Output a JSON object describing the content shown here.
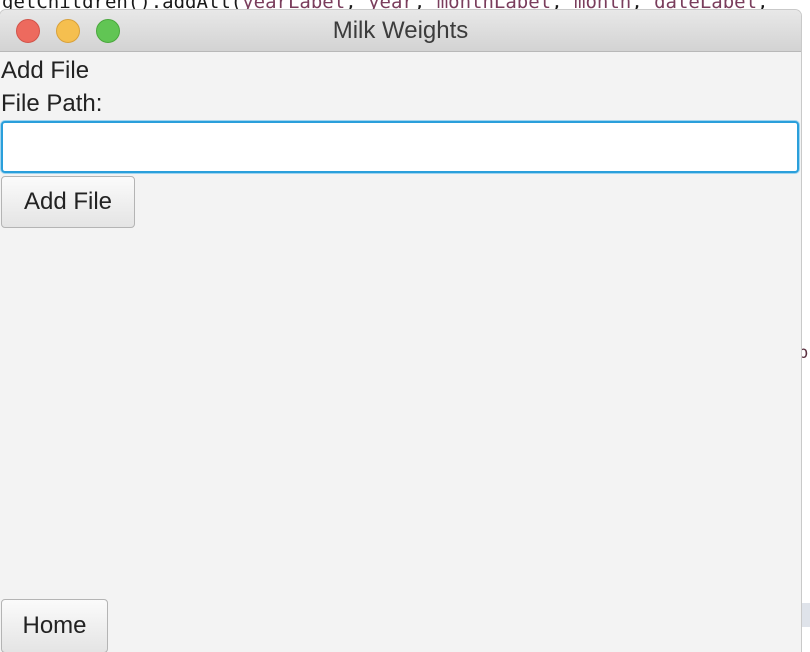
{
  "background": {
    "code_text_plain_1": "getChildren().addAll(",
    "code_text_hl_1": "yearLabel",
    "code_text_plain_2": ", ",
    "code_text_hl_2": "year",
    "code_text_plain_3": ", ",
    "code_text_hl_3": "monthLabel",
    "code_text_plain_4": ", ",
    "code_text_hl_4": "month",
    "code_text_plain_5": ", ",
    "code_text_hl_5": "dateLabel",
    "code_text_plain_6": ",",
    "code_fragment": "b"
  },
  "window": {
    "title": "Milk Weights"
  },
  "form": {
    "heading": "Add File",
    "file_path_label": "File Path:",
    "file_path_value": "",
    "file_path_placeholder": "",
    "add_file_button": "Add File"
  },
  "footer": {
    "home_button": "Home"
  },
  "colors": {
    "focus_ring": "#2a9fdb",
    "window_bg": "#f3f3f3",
    "close": "#ed6a5e",
    "minimize": "#f5bf4f",
    "maximize": "#61c554"
  }
}
